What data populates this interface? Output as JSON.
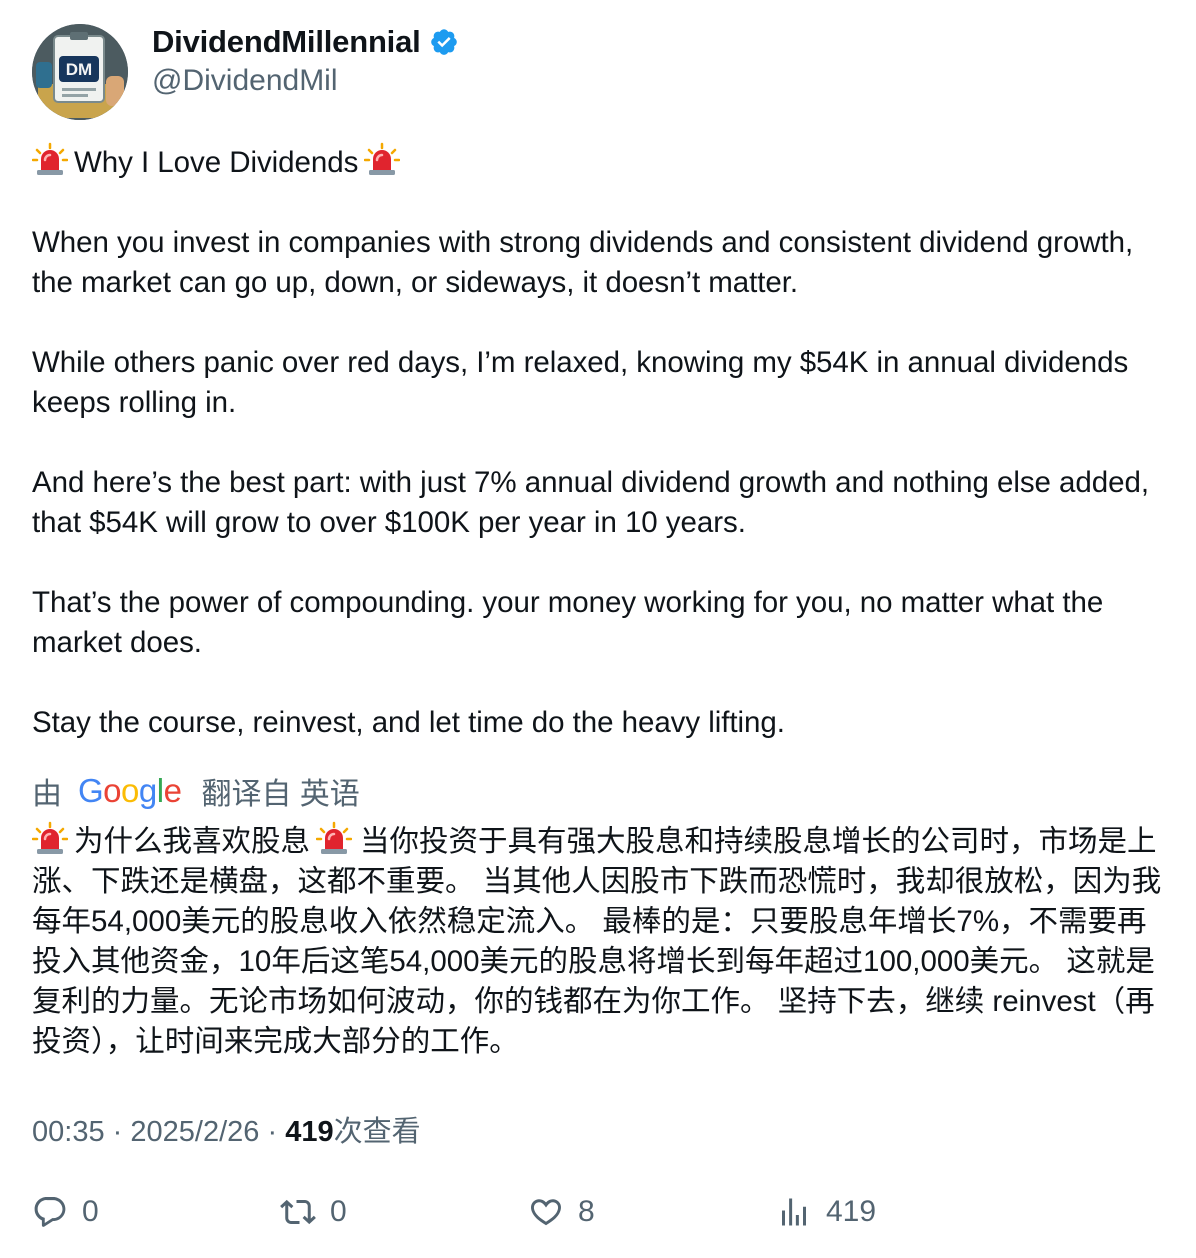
{
  "author": {
    "display_name": "DividendMillennial",
    "handle": "@DividendMil",
    "avatar_monogram": "DM",
    "verified_icon": "verified-badge-icon",
    "verified_color": "#1d9bf0"
  },
  "tweet": {
    "title": "Why I Love Dividends",
    "title_icon": "police-light-siren-emoji",
    "paragraphs": [
      "When you invest in companies with strong dividends and consistent dividend growth, the market can go up, down, or sideways, it doesn’t matter.",
      "While others panic over red days, I’m relaxed, knowing my $54K in annual dividends keeps rolling in.",
      "And here’s the best part: with just 7% annual dividend growth and nothing else added, that $54K will grow to over $100K per year in 10 years.",
      "That’s the power of compounding.  your money working for you, no matter what the market does.",
      "Stay the course, reinvest, and let time do the heavy lifting."
    ]
  },
  "translation": {
    "prefix": "由",
    "provider": "Google",
    "suffix": "翻译自 英语",
    "title": "为什么我喜欢股息",
    "body": "当你投资于具有强大股息和持续股息增长的公司时，市场是上涨、下跌还是横盘，这都不重要。 当其他人因股市下跌而恐慌时，我却很放松，因为我每年54,000美元的股息收入依然稳定流入。 最棒的是：只要股息年增长7%，不需要再投入其他资金，10年后这笔54,000美元的股息将增长到每年超过100,000美元。 这就是复利的力量。无论市场如何波动，你的钱都在为你工作。 坚持下去，继续 reinvest（再投资），让时间来完成大部分的工作。"
  },
  "meta": {
    "time": "00:35",
    "separator": "·",
    "date": "2025/2/26",
    "views": "419",
    "views_label": "次查看"
  },
  "actions": {
    "reply": {
      "icon": "reply-icon",
      "count": "0"
    },
    "retweet": {
      "icon": "retweet-icon",
      "count": "0"
    },
    "like": {
      "icon": "heart-icon",
      "count": "8"
    },
    "views": {
      "icon": "analytics-icon",
      "count": "419"
    }
  },
  "colors": {
    "text": "#0f1419",
    "secondary": "#536471",
    "verified": "#1d9bf0",
    "siren": "#e0242e"
  }
}
